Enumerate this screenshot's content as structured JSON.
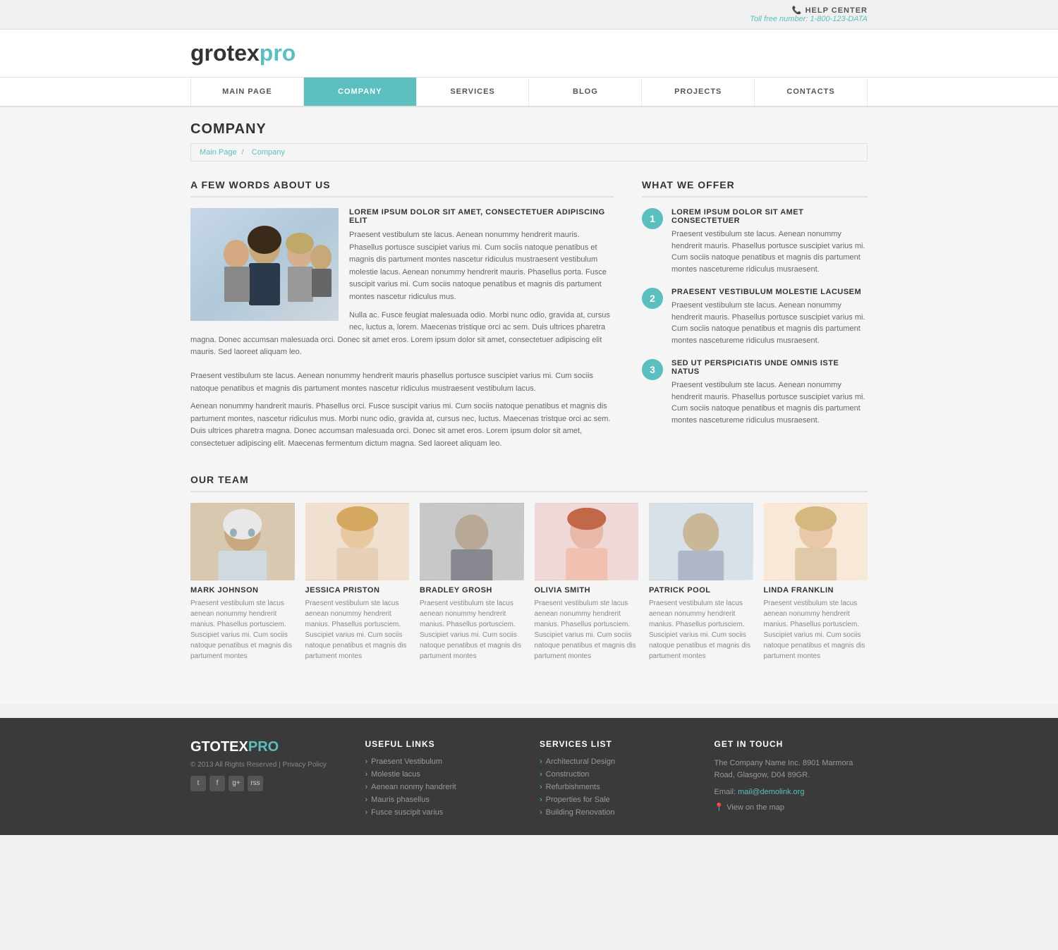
{
  "topbar": {
    "help_center_label": "HELP CENTER",
    "phone_label": "Toll free number:",
    "phone_number": "1-800-123-DATA"
  },
  "header": {
    "logo_main": "grotex",
    "logo_accent": "pro"
  },
  "nav": {
    "items": [
      {
        "label": "MAIN PAGE",
        "active": false
      },
      {
        "label": "COMPANY",
        "active": true
      },
      {
        "label": "SERVICES",
        "active": false
      },
      {
        "label": "BLOG",
        "active": false
      },
      {
        "label": "PROJECTS",
        "active": false
      },
      {
        "label": "CONTACTS",
        "active": false
      }
    ]
  },
  "page": {
    "title": "COMPANY",
    "breadcrumb_home": "Main Page",
    "breadcrumb_separator": "/",
    "breadcrumb_current": "Company"
  },
  "about": {
    "section_title": "A FEW WORDS ABOUT US",
    "article_title": "LOREM IPSUM DOLOR SIT AMET, CONSECTETUER ADIPISCING ELIT",
    "paragraph1": "Praesent vestibulum ste lacus. Aenean nonummy hendrerit mauris. Phasellus portusce suscipiet varius mi. Cum sociis natoque penatibus et magnis dis partument montes nascetur ridiculus mustraesent vestibulum molestie lacus. Aenean nonummy hendrerit mauris. Phasellus porta. Fusce suscipit varius mi. Cum sociis natoque penatibus et magnis dis partument montes nascetur ridiculus mus.",
    "paragraph2": "Nulla ac. Fusce feugiat malesuada odio. Morbi nunc odio, gravida at, cursus nec, luctus a, lorem. Maecenas tristique orci ac sem. Duis ultrices pharetra magna. Donec accumsan malesuada orci. Donec sit amet eros. Lorem ipsum dolor sit amet, consectetuer adipiscing elit mauris. Sed laoreet aliquam leo.",
    "paragraph3": "Praesent vestibulum ste lacus. Aenean nonummy hendrerit mauris phasellus portusce suscipiet varius mi. Cum sociis natoque penatibus et magnis dis partument montes nascetur ridiculus mustraesent vestibulum lacus.",
    "paragraph4": "Aenean nonummy handrerit mauris. Phasellus orci. Fusce suscipit varius mi. Cum sociis natoque penatibus et magnis dis partument montes, nascetur ridiculus mus. Morbi nunc odio, gravida at, cursus nec, luctus. Maecenas tristque orci ac sem. Duis ultrices pharetra magna. Donec accumsan malesuada orci. Donec sit amet eros. Lorem ipsum dolor sit amet, consectetuer adipiscing elit. Maecenas fermentum dictum magna. Sed laoreet aliquam leo."
  },
  "offer": {
    "section_title": "WHAT WE OFFER",
    "items": [
      {
        "number": "1",
        "title": "LOREM IPSUM DOLOR SIT AMET CONSECTETUER",
        "text": "Praesent vestibulum ste lacus. Aenean nonummy hendrerit mauris. Phasellus portusce suscipiet varius mi. Cum sociis natoque penatibus et magnis dis partument montes nascetureme ridiculus musraesent."
      },
      {
        "number": "2",
        "title": "PRAESENT VESTIBULUM MOLESTIE LACUSEM",
        "text": "Praesent vestibulum ste lacus. Aenean nonummy hendrerit mauris. Phasellus portusce suscipiet varius mi. Cum sociis natoque penatibus et magnis dis partument montes nascetureme ridiculus musraesent."
      },
      {
        "number": "3",
        "title": "SED UT PERSPICIATIS UNDE OMNIS ISTE NATUS",
        "text": "Praesent vestibulum ste lacus. Aenean nonummy hendrerit mauris. Phasellus portusce suscipiet varius mi. Cum sociis natoque penatibus et magnis dis partument montes nascetureme ridiculus musraesent."
      }
    ]
  },
  "team": {
    "section_title": "OUR TEAM",
    "members": [
      {
        "name": "MARK JOHNSON",
        "text": "Praesent vestibulum ste lacus aenean nonummy hendrerit manius. Phasellus portusciem. Suscipiet varius mi. Cum sociis natoque penatibus et magnis dis partument montes"
      },
      {
        "name": "JESSICA PRISTON",
        "text": "Praesent vestibulum ste lacus aenean nonummy hendrerit manius. Phasellus portusciem. Suscipiet varius mi. Cum sociis natoque penatibus et magnis dis partument montes"
      },
      {
        "name": "BRADLEY GROSH",
        "text": "Praesent vestibulum ste lacus aenean nonummy hendrerit manius. Phasellus portusciem. Suscipiet varius mi. Cum sociis natoque penatibus et magnis dis partument montes"
      },
      {
        "name": "OLIVIA SMITH",
        "text": "Praesent vestibulum ste lacus aenean nonummy hendrerit manius. Phasellus portusciem. Suscipiet varius mi. Cum sociis natoque penatibus et magnis dis partument montes"
      },
      {
        "name": "PATRICK POOL",
        "text": "Praesent vestibulum ste lacus aenean nonummy hendrerit manius. Phasellus portusciem. Suscipiet varius mi. Cum sociis natoque penatibus et magnis dis partument montes"
      },
      {
        "name": "LINDA FRANKLIN",
        "text": "Praesent vestibulum ste lacus aenean nonummy hendrerit manius. Phasellus portusciem. Suscipiet varius mi. Cum sociis natoque penatibus et magnis dis partument montes"
      }
    ]
  },
  "footer": {
    "logo_main": "GTOTEX",
    "logo_accent": "PRO",
    "copyright": "© 2013 All Rights Reserved | Privacy Policy",
    "social_icons": [
      "tw",
      "fb",
      "gp",
      "rss"
    ],
    "useful_links_title": "USEFUL LINKS",
    "useful_links": [
      "Praesent Vestibulum",
      "Molestie lacus",
      "Aenean nonmy handrerit",
      "Mauris phasellus",
      "Fusce suscipit varius"
    ],
    "services_title": "SERVICES LIST",
    "services": [
      "Architectural Design",
      "Construction",
      "Refurbishments",
      "Properties for Sale",
      "Building Renovation"
    ],
    "contact_title": "GET IN TOUCH",
    "address": "The Company Name Inc. 8901 Marmora Road, Glasgow, D04 89GR.",
    "email_label": "Email:",
    "email": "mail@demolink.org",
    "map_label": "View on the map"
  }
}
